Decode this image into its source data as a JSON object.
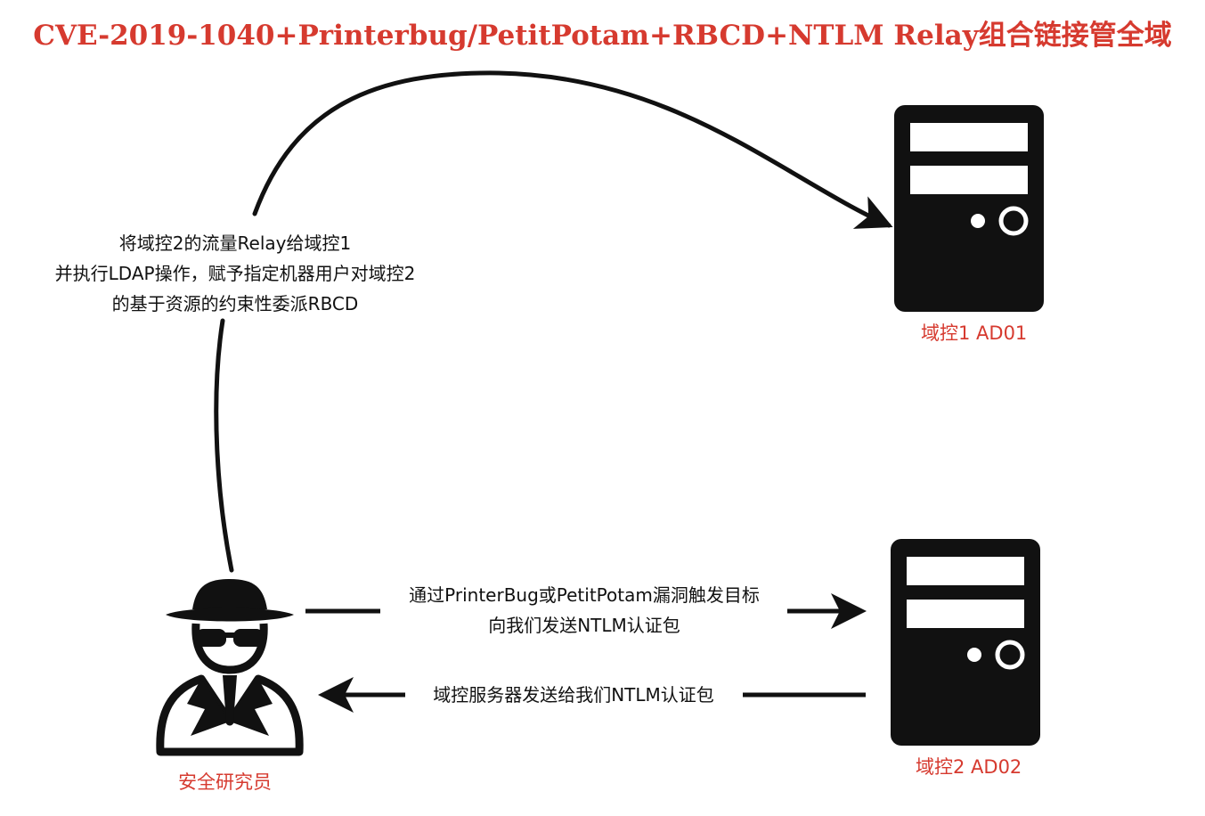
{
  "title": "CVE-2019-1040+Printerbug/PetitPotam+RBCD+NTLM  Relay组合链接管全域",
  "colors": {
    "accent_red": "#d63a2f",
    "ink": "#111111",
    "background": "#ffffff"
  },
  "nodes": {
    "dc1_label": "域控1 AD01",
    "dc2_label": "域控2 AD02",
    "researcher_label": "安全研究员"
  },
  "icons": {
    "dc1": "server-tower-icon",
    "dc2": "server-tower-icon",
    "researcher": "spy-hacker-icon"
  },
  "edges": {
    "relay": {
      "line1": "将域控2的流量Relay给域控1",
      "line2": "并执行LDAP操作，赋予指定机器用户对域控2",
      "line3": "的基于资源的约束性委派RBCD"
    },
    "trigger": {
      "line1": "通过PrinterBug或PetitPotam漏洞触发目标",
      "line2": "向我们发送NTLM认证包"
    },
    "response": {
      "line1": "域控服务器发送给我们NTLM认证包"
    }
  }
}
